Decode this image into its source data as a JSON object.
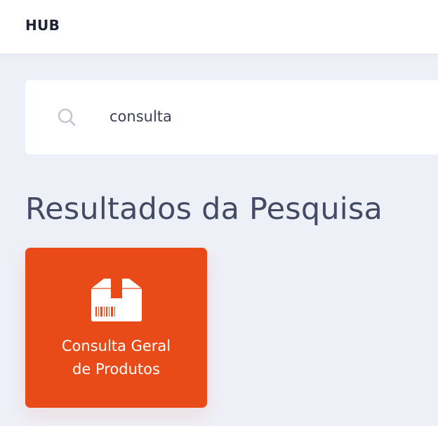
{
  "header": {
    "brand": "HUB"
  },
  "search": {
    "value": "consulta",
    "icon": "search-icon"
  },
  "results": {
    "title": "Resultados da Pesquisa",
    "items": [
      {
        "label_line1": "Consulta Geral",
        "label_line2": "de Produtos",
        "icon": "package-barcode-icon",
        "color": "#e84b17"
      }
    ]
  },
  "colors": {
    "background": "#eef0f8",
    "accent": "#e84b17",
    "title_text": "#434a63"
  }
}
